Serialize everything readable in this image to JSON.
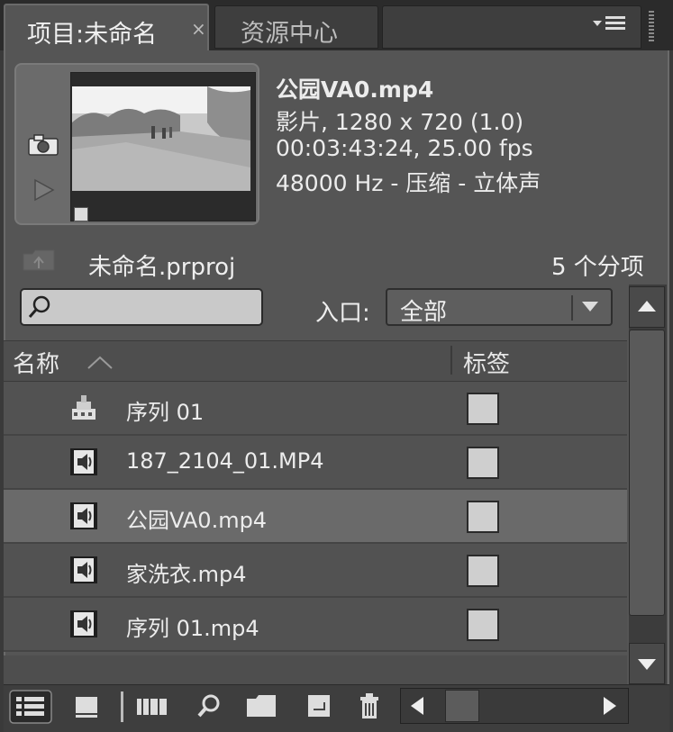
{
  "tabs": [
    {
      "label": "项目:未命名",
      "close": "×",
      "active": true
    },
    {
      "label": "资源中心",
      "active": false
    }
  ],
  "clip": {
    "name": "公园VA0.mp4",
    "type": "影片, 1280 x 720 (1.0)",
    "duration": "00:03:43:24, 25.00 fps",
    "audio": "48000 Hz - 压缩 - 立体声"
  },
  "project": {
    "name": "未命名.prproj",
    "count": "5 个分项"
  },
  "entry": {
    "label": "入口:",
    "value": "全部"
  },
  "columns": {
    "name": "名称",
    "label": "标签"
  },
  "items": [
    {
      "name": "序列 01",
      "icon": "sequence-icon",
      "selected": false
    },
    {
      "name": "187_2104_01.MP4",
      "icon": "media-clip-icon",
      "selected": false
    },
    {
      "name": "公园VA0.mp4",
      "icon": "media-clip-icon",
      "selected": true
    },
    {
      "name": "家洗衣.mp4",
      "icon": "media-clip-icon",
      "selected": false
    },
    {
      "name": "序列 01.mp4",
      "icon": "media-clip-icon",
      "selected": false
    }
  ],
  "colors": {
    "panel": "#555555",
    "selected_row": "#6a6a6a",
    "label_swatch": "#cfcfcf"
  }
}
